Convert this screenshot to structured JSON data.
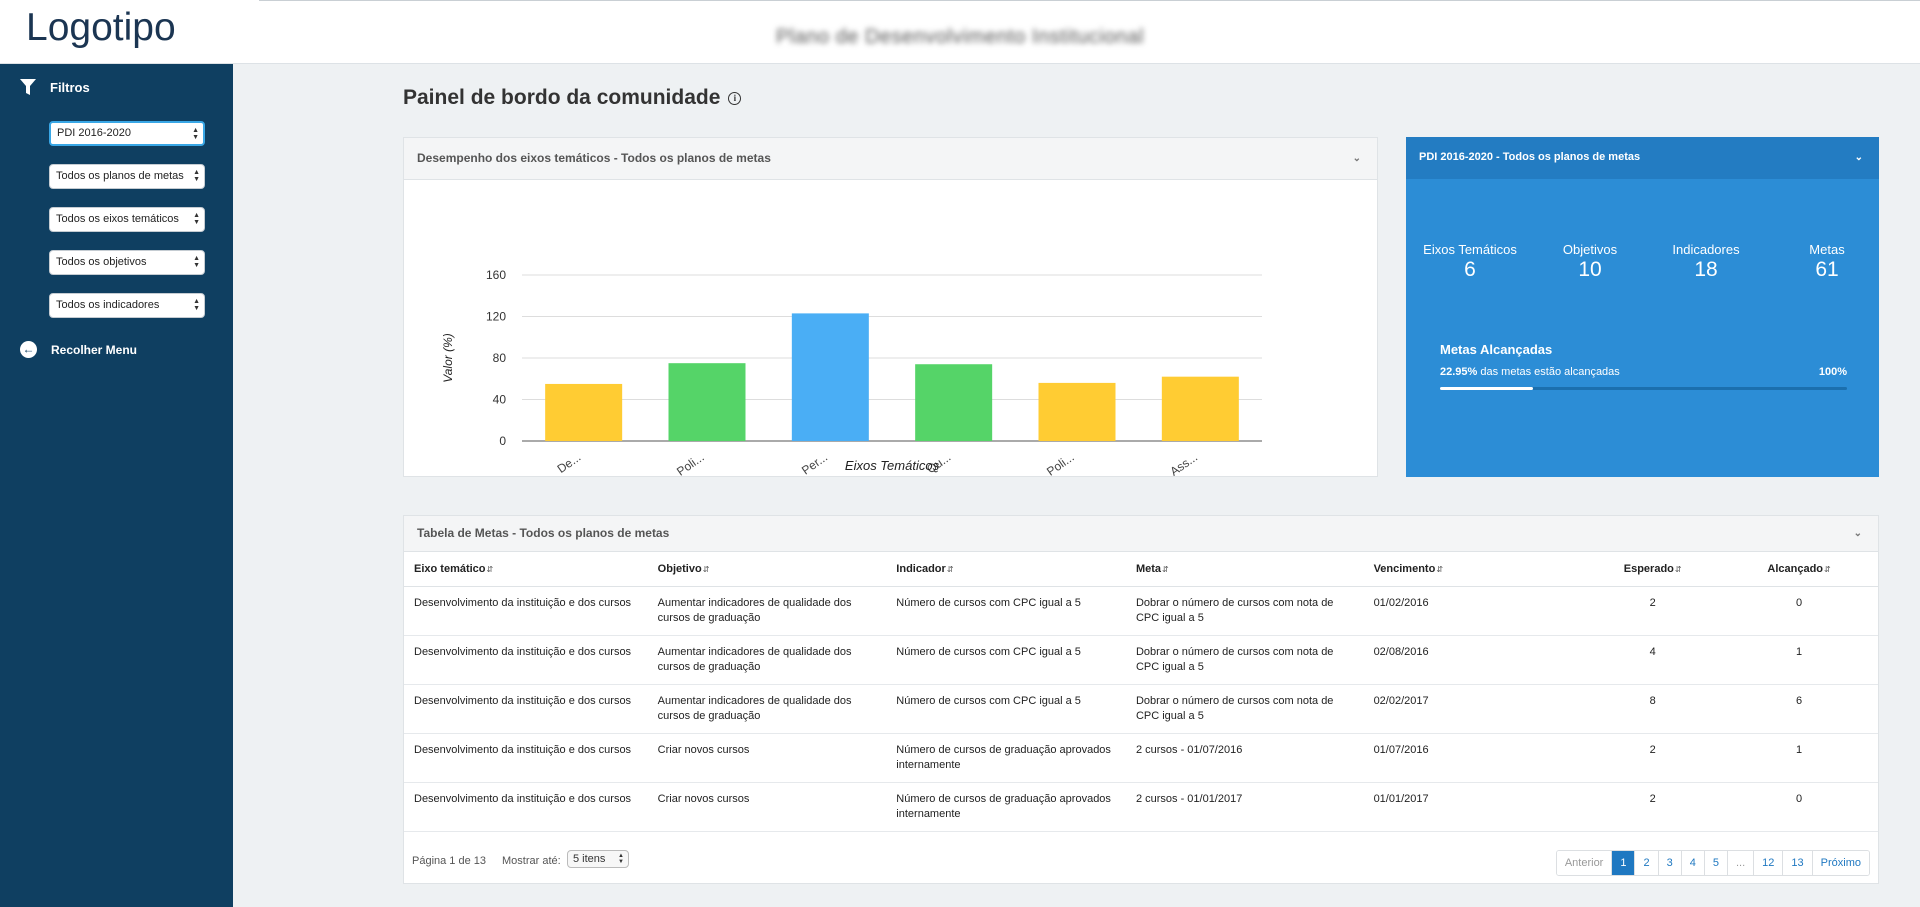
{
  "header": {
    "logo": "Logotipo",
    "app_title": "Plano de Desenvolvimento Institucional"
  },
  "sidebar": {
    "filters_label": "Filtros",
    "selects": [
      {
        "value": "PDI 2016-2020"
      },
      {
        "value": "Todos os planos de metas"
      },
      {
        "value": "Todos os eixos temáticos"
      },
      {
        "value": "Todos os objetivos"
      },
      {
        "value": "Todos os indicadores"
      }
    ],
    "collapse_label": "Recolher Menu"
  },
  "main": {
    "page_title": "Painel de bordo da comunidade"
  },
  "chart_panel": {
    "title": "Desempenho dos eixos temáticos - Todos os planos de metas"
  },
  "chart_data": {
    "type": "bar",
    "categories": [
      "De...",
      "Poli...",
      "Per...",
      "Qu...",
      "Poli...",
      "Ass..."
    ],
    "values": [
      55,
      75,
      123,
      74,
      56,
      62
    ],
    "colors": [
      "#ffcc33",
      "#55d468",
      "#4aaef5",
      "#55d468",
      "#ffcc33",
      "#ffcc33"
    ],
    "xlabel": "Eixos Temáticos",
    "ylabel": "Valor (%)",
    "yticks": [
      0,
      40,
      80,
      120,
      160
    ],
    "ylim": [
      0,
      160
    ],
    "grid": true
  },
  "stats_panel": {
    "title": "PDI 2016-2020 - Todos os planos de metas",
    "stats": [
      {
        "label": "Eixos Temáticos",
        "value": "6"
      },
      {
        "label": "Objetivos",
        "value": "10"
      },
      {
        "label": "Indicadores",
        "value": "18"
      },
      {
        "label": "Metas",
        "value": "61"
      }
    ],
    "metas_title": "Metas Alcançadas",
    "metas_percent": "22.95%",
    "metas_text": "das metas estão alcançadas",
    "metas_total": "100%",
    "progress": 0.2295
  },
  "table": {
    "title": "Tabela de Metas - Todos os planos de metas",
    "columns": [
      "Eixo temático",
      "Objetivo",
      "Indicador",
      "Meta",
      "Vencimento",
      "Esperado",
      "Alcançado"
    ],
    "rows": [
      [
        "Desenvolvimento da instituição e dos cursos",
        "Aumentar indicadores de qualidade dos cursos de graduação",
        "Número de cursos com CPC igual a 5",
        "Dobrar o número de cursos com nota de CPC igual a 5",
        "01/02/2016",
        "2",
        "0"
      ],
      [
        "Desenvolvimento da instituição e dos cursos",
        "Aumentar indicadores de qualidade dos cursos de graduação",
        "Número de cursos com CPC igual a 5",
        "Dobrar o número de cursos com nota de CPC igual a 5",
        "02/08/2016",
        "4",
        "1"
      ],
      [
        "Desenvolvimento da instituição e dos cursos",
        "Aumentar indicadores de qualidade dos cursos de graduação",
        "Número de cursos com CPC igual a 5",
        "Dobrar o número de cursos com nota de CPC igual a 5",
        "02/02/2017",
        "8",
        "6"
      ],
      [
        "Desenvolvimento da instituição e dos cursos",
        "Criar novos cursos",
        "Número de cursos de graduação aprovados internamente",
        "2 cursos - 01/07/2016",
        "01/07/2016",
        "2",
        "1"
      ],
      [
        "Desenvolvimento da instituição e dos cursos",
        "Criar novos cursos",
        "Número de cursos de graduação aprovados internamente",
        "2 cursos - 01/01/2017",
        "01/01/2017",
        "2",
        "0"
      ]
    ],
    "page_info": "Página 1 de 13",
    "show_label": "Mostrar até:",
    "show_value": "5 itens",
    "pager": [
      "Anterior",
      "1",
      "2",
      "3",
      "4",
      "5",
      "...",
      "12",
      "13",
      "Próximo"
    ]
  }
}
